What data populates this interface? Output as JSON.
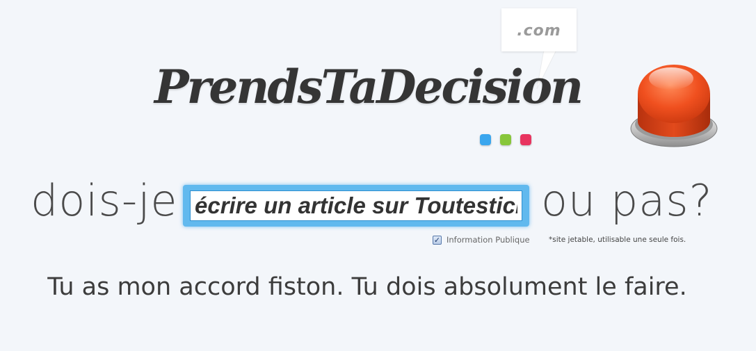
{
  "logo": {
    "text": "PrendsTaDecision",
    "bubble_text": ".com"
  },
  "dots": [
    {
      "name": "blue-dot",
      "color": "#3aa6ee"
    },
    {
      "name": "green-dot",
      "color": "#87c63a"
    },
    {
      "name": "pink-dot",
      "color": "#e8345f"
    }
  ],
  "question": {
    "prefix": "dois-je",
    "input_value": "écrire un article sur Toutestici.e",
    "suffix": "ou pas?"
  },
  "options": {
    "public_label": "Information Publique",
    "public_checked": true,
    "note": "*site jetable, utilisable une seule fois."
  },
  "answer": {
    "text": "Tu as mon accord fiston. Tu dois absolument le faire."
  },
  "colors": {
    "background": "#f3f6fa",
    "input_glow": "#61b9ee",
    "button_red": "#e8461b",
    "text_dark": "#353535"
  }
}
